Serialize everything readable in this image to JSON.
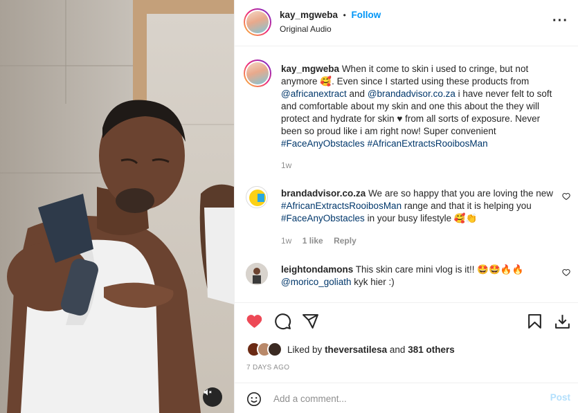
{
  "header": {
    "username": "kay_mgweba",
    "separator": "•",
    "follow_label": "Follow",
    "audio": "Original Audio",
    "more_icon": "more-horizontal-icon"
  },
  "caption": {
    "username": "kay_mgweba",
    "text_1": "When it come to skin i used to cringe, but not anymore 🥰. Even since I started using these products from",
    "mention_1": "@africanextract",
    "text_2": "and",
    "mention_2": "@brandadvisor.co.za",
    "text_3": "i have never felt to soft and comfortable about my skin and one this about the they will protect and hydrate for skin ♥ from all sorts of exposure. Never been so proud like i am right now! Super convenient",
    "hashtag_1": "#FaceAnyObstacles",
    "hashtag_2": "#AfricanExtractsRooibosMan",
    "time": "1w"
  },
  "comments": [
    {
      "username": "brandadvisor.co.za",
      "text_1": "We are so happy that you are loving the new",
      "hashtag_1": "#AfricanExtractsRooibosMan",
      "text_2": "range and that it is helping you",
      "hashtag_2": "#FaceAnyObstacles",
      "text_3": "in your busy lifestyle 🥰👏",
      "time": "1w",
      "likes": "1 like",
      "reply": "Reply"
    },
    {
      "username": "leightondamons",
      "text_1": "This skin care mini vlog is it!! 🤩🤩🔥🔥",
      "mention_1": "@morico_goliath",
      "text_2": "kyk hier :)"
    }
  ],
  "actions": {
    "liked": true,
    "liked_by_label": "Liked by",
    "liked_by_user": "theversatilesa",
    "and_label": "and",
    "others": "381 others",
    "date": "7 DAYS AGO"
  },
  "add_comment": {
    "placeholder": "Add a comment...",
    "post_label": "Post"
  },
  "colors": {
    "accent": "#0095f6",
    "like_red": "#ed4956",
    "link": "#00376b",
    "muted": "#8e8e8e"
  }
}
